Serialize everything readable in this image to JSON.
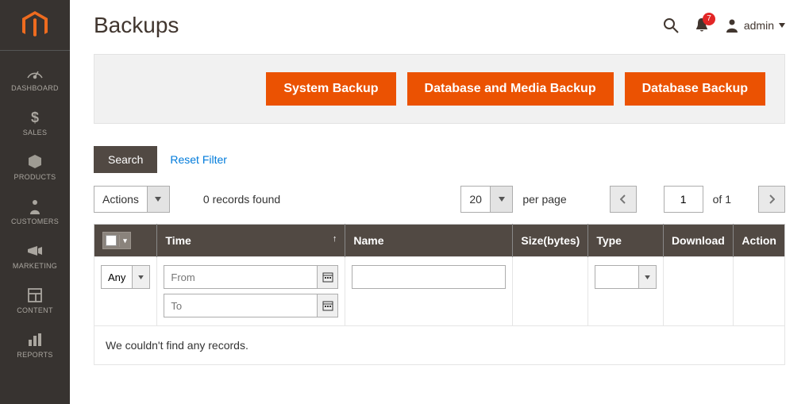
{
  "page": {
    "title": "Backups"
  },
  "user": {
    "name": "admin"
  },
  "notifications": {
    "count": "7"
  },
  "sidebar": {
    "items": [
      {
        "label": "DASHBOARD"
      },
      {
        "label": "SALES"
      },
      {
        "label": "PRODUCTS"
      },
      {
        "label": "CUSTOMERS"
      },
      {
        "label": "MARKETING"
      },
      {
        "label": "CONTENT"
      },
      {
        "label": "REPORTS"
      }
    ]
  },
  "buttons": {
    "system_backup": "System Backup",
    "db_media_backup": "Database and Media Backup",
    "db_backup": "Database Backup",
    "search": "Search",
    "reset_filter": "Reset Filter",
    "actions": "Actions"
  },
  "grid": {
    "records_found": "0 records found",
    "per_page_value": "20",
    "per_page_label": "per page",
    "page_current": "1",
    "page_total": "of 1",
    "columns": {
      "time": "Time",
      "name": "Name",
      "size": "Size(bytes)",
      "type": "Type",
      "download": "Download",
      "action": "Action"
    },
    "filters": {
      "select_any": "Any",
      "time_from_placeholder": "From",
      "time_to_placeholder": "To"
    },
    "empty": "We couldn't find any records."
  }
}
